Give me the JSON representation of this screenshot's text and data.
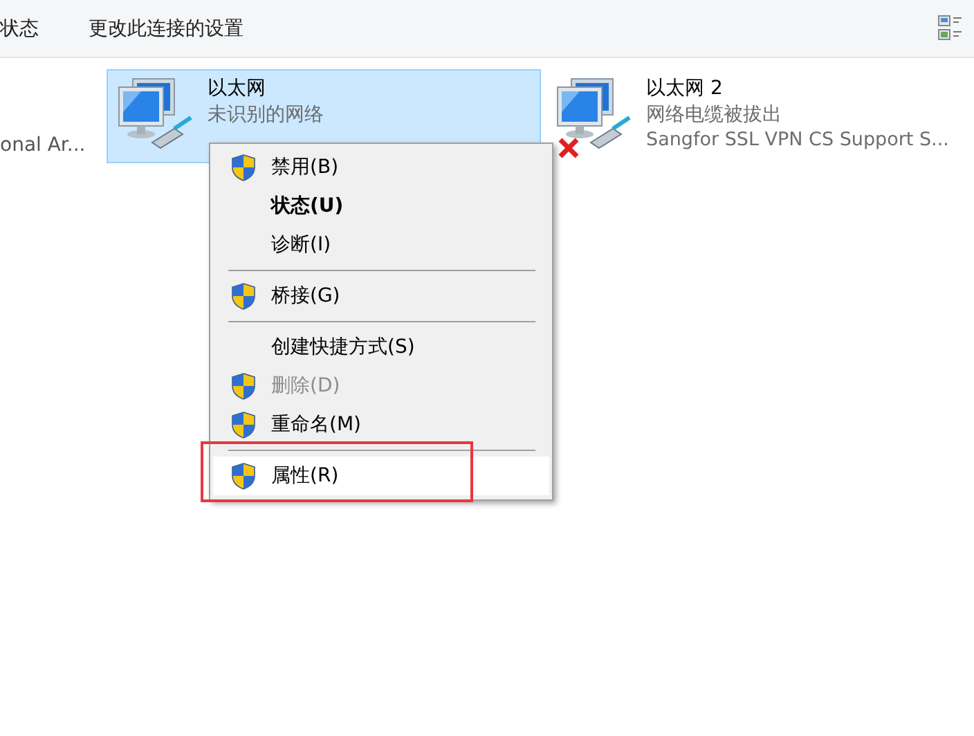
{
  "toolbar": {
    "items": [
      {
        "label": "状态"
      },
      {
        "label": "更改此连接的设置"
      }
    ]
  },
  "partial_connection": {
    "device": "onal Ar..."
  },
  "connections": [
    {
      "name": "以太网",
      "status": "未识别的网络",
      "selected": true,
      "disconnected": false
    },
    {
      "name": "以太网 2",
      "status": "网络电缆被拔出",
      "device": "Sangfor SSL VPN CS Support S...",
      "selected": false,
      "disconnected": true
    }
  ],
  "context_menu": {
    "items": [
      {
        "kind": "item",
        "label": "禁用(B)",
        "shield": true,
        "default": false,
        "disabled": false,
        "hovered": false,
        "annotated": false
      },
      {
        "kind": "item",
        "label": "状态(U)",
        "shield": false,
        "default": true,
        "disabled": false,
        "hovered": false,
        "annotated": false
      },
      {
        "kind": "item",
        "label": "诊断(I)",
        "shield": false,
        "default": false,
        "disabled": false,
        "hovered": false,
        "annotated": false
      },
      {
        "kind": "separator"
      },
      {
        "kind": "item",
        "label": "桥接(G)",
        "shield": true,
        "default": false,
        "disabled": false,
        "hovered": false,
        "annotated": false
      },
      {
        "kind": "separator"
      },
      {
        "kind": "item",
        "label": "创建快捷方式(S)",
        "shield": false,
        "default": false,
        "disabled": false,
        "hovered": false,
        "annotated": false
      },
      {
        "kind": "item",
        "label": "删除(D)",
        "shield": true,
        "default": false,
        "disabled": true,
        "hovered": false,
        "annotated": false
      },
      {
        "kind": "item",
        "label": "重命名(M)",
        "shield": true,
        "default": false,
        "disabled": false,
        "hovered": false,
        "annotated": false
      },
      {
        "kind": "separator"
      },
      {
        "kind": "item",
        "label": "属性(R)",
        "shield": true,
        "default": false,
        "disabled": false,
        "hovered": true,
        "annotated": true
      }
    ]
  }
}
